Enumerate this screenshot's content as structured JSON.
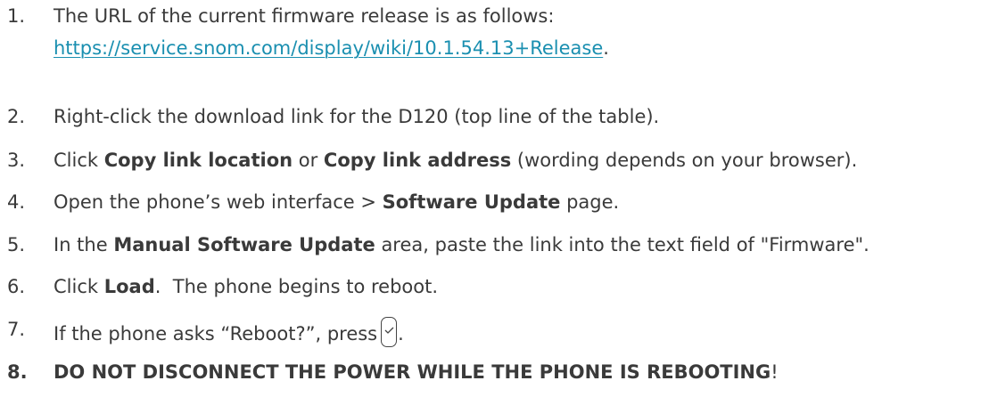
{
  "steps": [
    {
      "number": "1.",
      "line1": "The URL of the current firmware release is as follows:",
      "link": "https://service.snom.com/display/wiki/10.1.54.13+Release",
      "after_link": "."
    },
    {
      "number": "2.",
      "text": "Right-click the download link for the D120 (top line of the table)."
    },
    {
      "number": "3.",
      "pre": "Click ",
      "bold1": "Copy link location",
      "mid": " or ",
      "bold2": "Copy link address",
      "post": " (wording depends on your browser)."
    },
    {
      "number": "4.",
      "pre": "Open the phone’s web interface > ",
      "bold": "Software Update",
      "post": " page."
    },
    {
      "number": "5.",
      "pre": "In the ",
      "bold": "Manual Software Update",
      "post": " area, paste the link into the text field of \"Firmware\"."
    },
    {
      "number": "6.",
      "pre": "Click ",
      "bold": "Load",
      "post": ".  The phone begins to reboot."
    },
    {
      "number": "7.",
      "pre": "If the phone asks “Reboot?”, press",
      "icon": "ok-key-icon",
      "post": "."
    },
    {
      "number": "8.",
      "bold": "DO NOT DISCONNECT THE POWER WHILE THE PHONE IS REBOOTING",
      "post": "!"
    }
  ],
  "colors": {
    "text": "#3a3a3a",
    "link": "#1a8fb0"
  }
}
